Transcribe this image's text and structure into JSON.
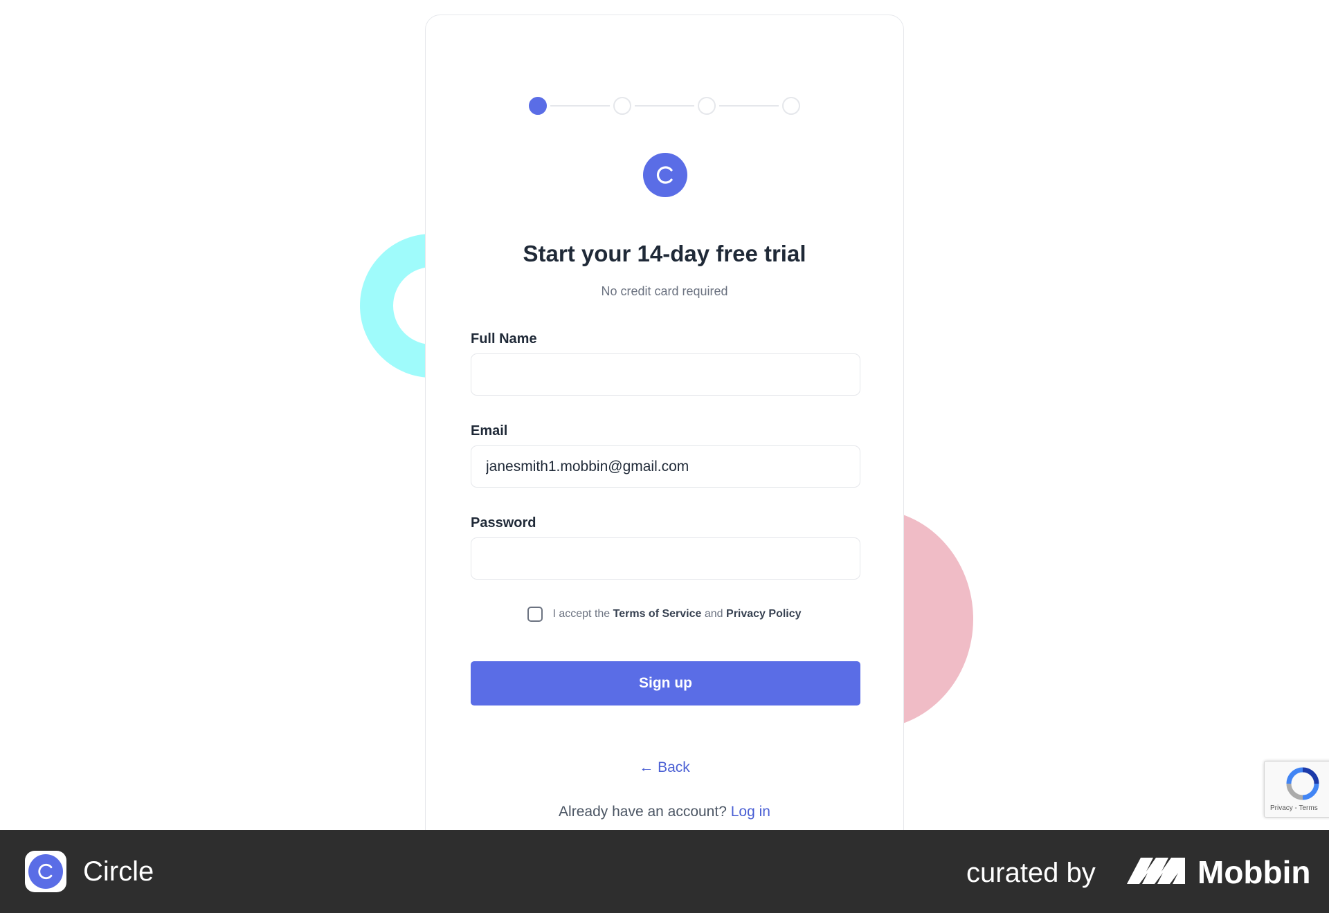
{
  "stepper": {
    "total_steps": 4,
    "current_step": 1
  },
  "logo": {
    "letter": "C",
    "icon": "circle-c-logo-icon"
  },
  "heading": {
    "title": "Start your 14-day free trial",
    "subtitle": "No credit card required"
  },
  "form": {
    "full_name": {
      "label": "Full Name",
      "value": "",
      "placeholder": ""
    },
    "email": {
      "label": "Email",
      "value": "janesmith1.mobbin@gmail.com",
      "placeholder": ""
    },
    "password": {
      "label": "Password",
      "value": "",
      "placeholder": ""
    }
  },
  "terms": {
    "prefix": "I accept the",
    "terms_link": "Terms of Service",
    "conjunction": "and",
    "privacy_link": "Privacy Policy",
    "checked": false
  },
  "signup_button": {
    "label": "Sign up"
  },
  "back_link": {
    "arrow": "←",
    "label": "Back"
  },
  "login_prompt": {
    "text": "Already have an account?",
    "link": "Log in"
  },
  "recaptcha": {
    "text": "Privacy - Terms",
    "icon": "recaptcha-icon"
  },
  "footer": {
    "app_name": "Circle",
    "curated_by": "curated by",
    "brand": "Mobbin",
    "brand_icon": "mobbin-logo-icon"
  },
  "colors": {
    "accent": "#5a6de6",
    "link": "#4a5fd4",
    "decor_cyan": "#9ffbfb",
    "decor_pink": "#f0bcc6",
    "footer_bg": "#2e2e2e"
  }
}
